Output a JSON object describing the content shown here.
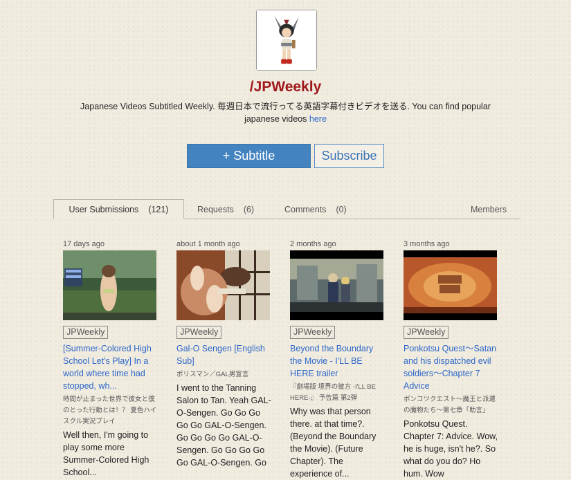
{
  "channel": {
    "title": "/JPWeekly",
    "description": "Japanese Videos Subtitled Weekly. 毎週日本で流行ってる英語字幕付きビデオを送る. You can find popular japanese videos",
    "description_link": "here"
  },
  "buttons": {
    "subtitle": "+ Subtitle",
    "subscribe": "Subscribe"
  },
  "tabs": [
    {
      "label": "User Submissions",
      "count": "(121)"
    },
    {
      "label": "Requests",
      "count": "(6)"
    },
    {
      "label": "Comments",
      "count": "(0)"
    },
    {
      "label": "Members",
      "count": ""
    }
  ],
  "cards": [
    {
      "ago": "17 days ago",
      "badge": "JPWeekly",
      "title": "[Summer-Colored High School Let's Play] In a world where time had stopped, wh...",
      "original": "時間が止まった世界で彼女と僕のとった行動とは！？ 夏色ハイスクル実況プレイ",
      "body": "Well then, I'm going to play some more Summer-Colored High School..."
    },
    {
      "ago": "about 1 month ago",
      "badge": "JPWeekly",
      "title": "Gal-O Sengen [English Sub]",
      "original": "ポリスマン／GAL男宣言",
      "body": "I went to the Tanning Salon to Tan. Yeah GAL-O-Sengen. Go Go Go Go Go GAL-O-Sengen. Go Go Go Go GAL-O-Sengen. Go Go Go Go Go GAL-O-Sengen. Go"
    },
    {
      "ago": "2 months ago",
      "badge": "JPWeekly",
      "title": "Beyond the Boundary the Movie - I'LL BE HERE trailer",
      "original": "『劇場版 境界の彼方 -I'LL BE HERE-』 予告篇 第2弾",
      "body": "Why was that person there. at that time?. (Beyond the Boundary the Movie). (Future Chapter). The experience of..."
    },
    {
      "ago": "3 months ago",
      "badge": "JPWeekly",
      "title": "Ponkotsu Quest〜Satan and his dispatched evil soldiers〜Chapter 7 Advice",
      "original": "ポンコツクエスト〜魔王と派遣の魔物たち〜第七章「助言」",
      "body": "Ponkotsu Quest. Chapter 7: Advice. Wow, he is huge, isn't he?. So what do you do? Ho hum. Wow"
    }
  ]
}
